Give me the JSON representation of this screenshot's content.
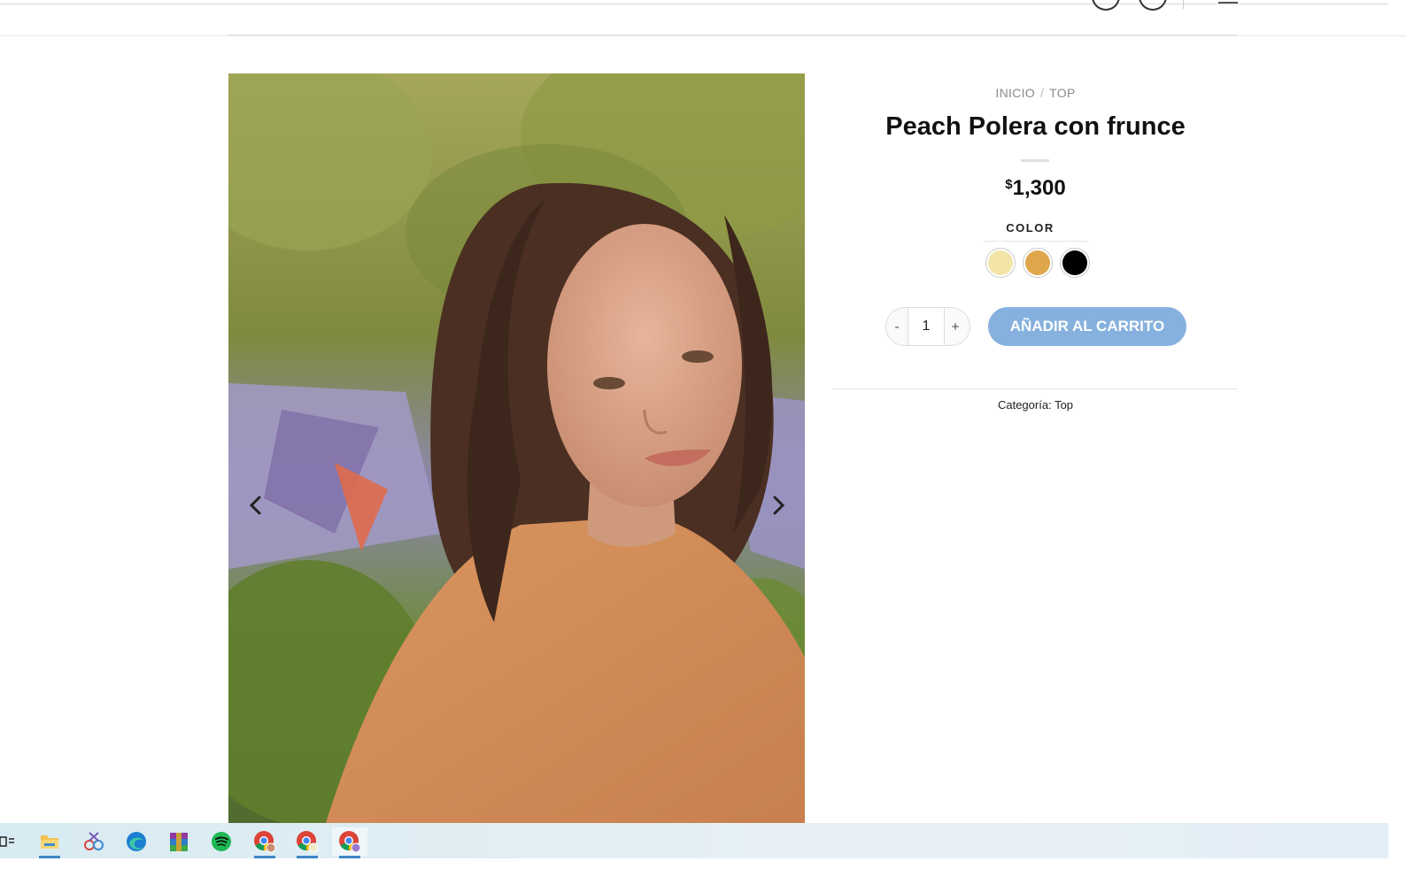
{
  "breadcrumb": {
    "items": [
      "INICIO",
      "TOP"
    ],
    "separator": "/"
  },
  "product": {
    "title": "Peach Polera con frunce",
    "currency_symbol": "$",
    "price": "1,300",
    "color_label": "COLOR",
    "colors": [
      {
        "name": "cream",
        "hex": "#f3e4a7"
      },
      {
        "name": "mustard",
        "hex": "#e0a64c"
      },
      {
        "name": "black",
        "hex": "#000000"
      }
    ],
    "quantity": "1",
    "qty_minus": "-",
    "qty_plus": "+",
    "add_to_cart": "AÑADIR AL CARRITO",
    "category_label": "Categoría:",
    "category_value": "Top"
  },
  "gallery": {
    "prev_icon": "chevron-left-icon",
    "next_icon": "chevron-right-icon"
  },
  "taskbar": {
    "icons": [
      "task-view-icon",
      "file-explorer-icon",
      "snipping-tool-icon",
      "edge-icon",
      "winrar-icon",
      "spotify-icon",
      "chrome-profile-1-icon",
      "chrome-profile-2-icon",
      "chrome-profile-3-icon"
    ]
  },
  "colors": {
    "accent_button": "#86b1de",
    "taskbar": "#d8ebf2"
  }
}
